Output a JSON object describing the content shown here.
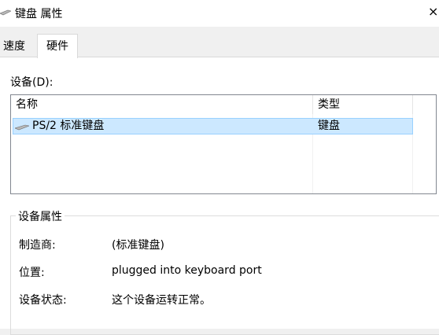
{
  "window": {
    "title": "键盘 属性",
    "close_glyph": "×"
  },
  "tabs": [
    {
      "label": "速度",
      "active": false
    },
    {
      "label": "硬件",
      "active": true
    }
  ],
  "devices": {
    "label": "设备(D):",
    "columns": [
      "名称",
      "类型"
    ],
    "rows": [
      {
        "name": "PS/2 标准键盘",
        "type": "键盘",
        "icon": "keyboard-icon",
        "selected": true
      }
    ]
  },
  "properties": {
    "group_title": "设备属性",
    "items": [
      {
        "label": "制造商:",
        "value": "(标准键盘)"
      },
      {
        "label": "位置:",
        "value": "plugged into keyboard port"
      },
      {
        "label": "设备状态:",
        "value": "这个设备运转正常。"
      }
    ]
  },
  "colors": {
    "selection_bg": "#cce8ff",
    "selection_border": "#99d1ff",
    "dialog_bg": "#f0f0f0"
  }
}
